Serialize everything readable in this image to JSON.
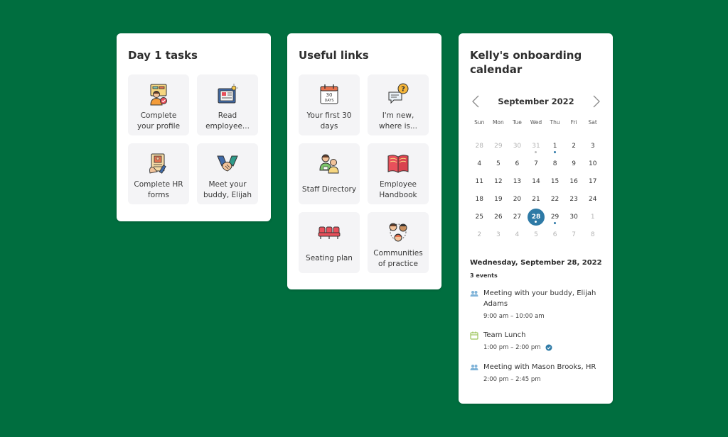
{
  "day1": {
    "title": "Day 1 tasks",
    "tiles": [
      {
        "label": "Complete\nyour profile",
        "icon": "profile-icon"
      },
      {
        "label": "Read\nemployee...",
        "icon": "newspaper-icon"
      },
      {
        "label": "Complete HR\nforms",
        "icon": "hr-forms-icon"
      },
      {
        "label": "Meet your\nbuddy, Elijah",
        "icon": "handshake-icon"
      }
    ]
  },
  "links": {
    "title": "Useful links",
    "tiles": [
      {
        "label": "Your first 30\ndays",
        "icon": "calendar-30-days-icon",
        "icon_text": "30\nDAYS"
      },
      {
        "label": "I'm new,\nwhere is...",
        "icon": "question-chat-icon"
      },
      {
        "label": "Staff Directory",
        "icon": "staff-directory-icon"
      },
      {
        "label": "Employee\nHandbook",
        "icon": "handbook-icon"
      },
      {
        "label": "Seating plan",
        "icon": "seating-plan-icon"
      },
      {
        "label": "Communities\nof practice",
        "icon": "communities-icon"
      }
    ]
  },
  "calendar": {
    "title": "Kelly's onboarding calendar",
    "month": "September 2022",
    "weekdays": [
      "Sun",
      "Mon",
      "Tue",
      "Wed",
      "Thu",
      "Fri",
      "Sat"
    ],
    "weeks": [
      [
        {
          "d": "28",
          "m": true
        },
        {
          "d": "29",
          "m": true
        },
        {
          "d": "30",
          "m": true
        },
        {
          "d": "31",
          "m": true,
          "dot": true
        },
        {
          "d": "1",
          "dot": true
        },
        {
          "d": "2"
        },
        {
          "d": "3"
        }
      ],
      [
        {
          "d": "4"
        },
        {
          "d": "5"
        },
        {
          "d": "6"
        },
        {
          "d": "7"
        },
        {
          "d": "8"
        },
        {
          "d": "9"
        },
        {
          "d": "10"
        }
      ],
      [
        {
          "d": "11"
        },
        {
          "d": "12"
        },
        {
          "d": "13"
        },
        {
          "d": "14"
        },
        {
          "d": "15"
        },
        {
          "d": "16"
        },
        {
          "d": "17"
        }
      ],
      [
        {
          "d": "18"
        },
        {
          "d": "19"
        },
        {
          "d": "20"
        },
        {
          "d": "21"
        },
        {
          "d": "22"
        },
        {
          "d": "23"
        },
        {
          "d": "24"
        }
      ],
      [
        {
          "d": "25"
        },
        {
          "d": "26"
        },
        {
          "d": "27"
        },
        {
          "d": "28",
          "sel": true,
          "dot": true
        },
        {
          "d": "29",
          "dot": true
        },
        {
          "d": "30"
        },
        {
          "d": "1",
          "m": true
        }
      ],
      [
        {
          "d": "2",
          "m": true
        },
        {
          "d": "3",
          "m": true
        },
        {
          "d": "4",
          "m": true
        },
        {
          "d": "5",
          "m": true
        },
        {
          "d": "6",
          "m": true
        },
        {
          "d": "7",
          "m": true
        },
        {
          "d": "8",
          "m": true
        }
      ]
    ],
    "selected_date": "Wednesday, September 28, 2022",
    "event_count": "3 events",
    "events": [
      {
        "title": "Meeting with your buddy, Elijah Adams",
        "time": "9:00 am – 10:00 am",
        "icon": "people-icon",
        "confirmed": false
      },
      {
        "title": "Team Lunch",
        "time": "1:00 pm – 2:00 pm",
        "icon": "calendar-event-icon",
        "confirmed": true
      },
      {
        "title": "Meeting with Mason Brooks, HR",
        "time": "2:00 pm – 2:45 pm",
        "icon": "people-icon",
        "confirmed": false
      }
    ]
  },
  "colors": {
    "background": "#006e3f",
    "accent": "#2e7aa6",
    "card": "#ffffff",
    "tile": "#f4f4f6"
  }
}
